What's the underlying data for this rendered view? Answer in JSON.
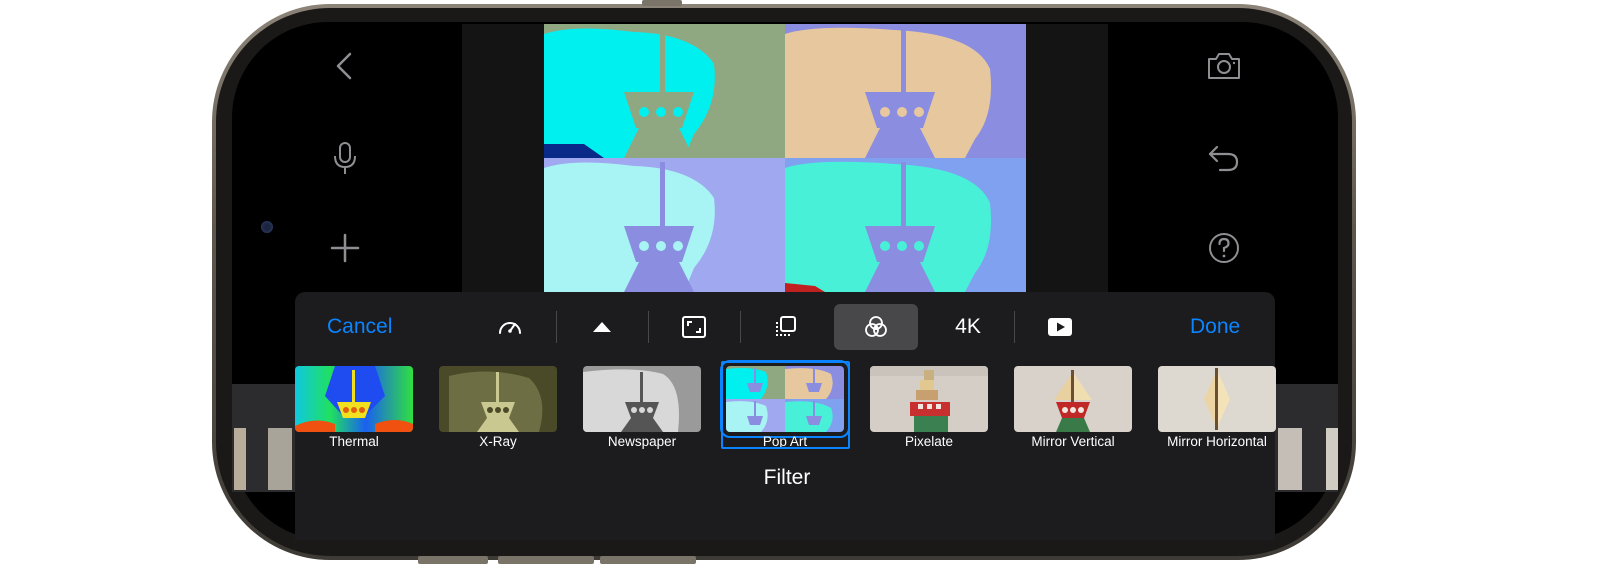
{
  "toolbar": {
    "cancel_label": "Cancel",
    "done_label": "Done",
    "resolution_label": "4K",
    "tools": [
      {
        "name": "speed",
        "icon": "speedometer-icon",
        "active": false
      },
      {
        "name": "volume",
        "icon": "triangle-up-icon",
        "active": false
      },
      {
        "name": "crop",
        "icon": "crop-frame-icon",
        "active": false
      },
      {
        "name": "layers",
        "icon": "layers-icon",
        "active": false
      },
      {
        "name": "filter",
        "icon": "filter-circles-icon",
        "active": true
      },
      {
        "name": "resolution",
        "icon": "4k-text",
        "active": false
      },
      {
        "name": "play",
        "icon": "play-icon",
        "active": false
      }
    ]
  },
  "side_controls": {
    "left": [
      "back-chevron-icon",
      "microphone-icon",
      "plus-icon"
    ],
    "right": [
      "camera-icon",
      "undo-icon",
      "help-icon"
    ]
  },
  "filters": {
    "selected": "Pop Art",
    "items": [
      {
        "label": "Thermal"
      },
      {
        "label": "X-Ray"
      },
      {
        "label": "Newspaper"
      },
      {
        "label": "Pop Art"
      },
      {
        "label": "Pixelate"
      },
      {
        "label": "Mirror Vertical"
      },
      {
        "label": "Mirror Horizontal"
      }
    ]
  },
  "panel": {
    "title": "Filter"
  },
  "colors": {
    "accent": "#0a84ff",
    "panel_bg": "#1c1c1e",
    "active_tool_bg": "#48484a"
  }
}
